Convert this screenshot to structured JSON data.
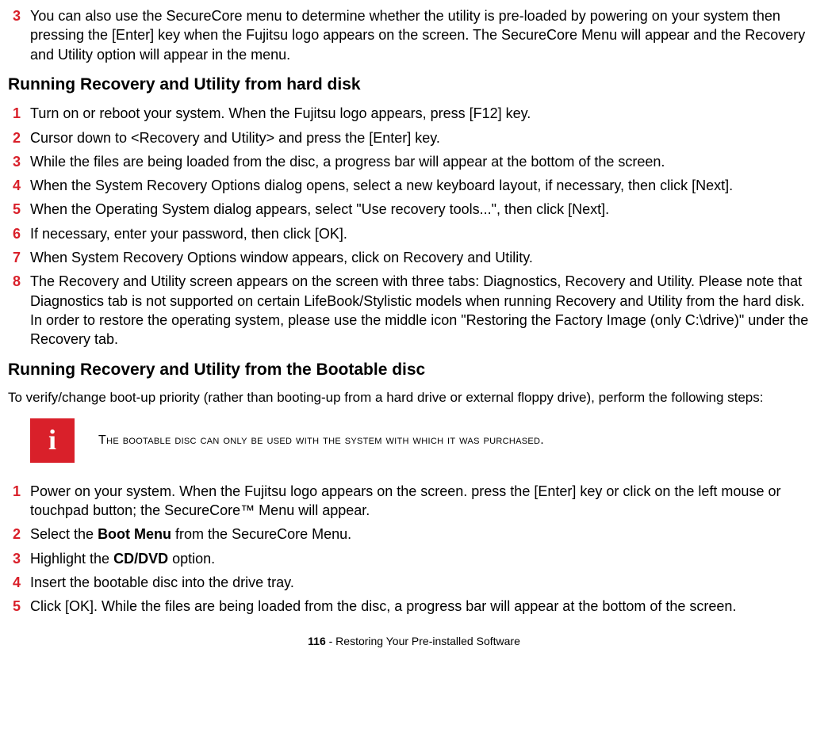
{
  "intro": {
    "num": "3",
    "text": "You can also use the SecureCore menu to determine whether the utility is pre-loaded by powering on your system then pressing the [Enter] key when the Fujitsu logo appears on the screen. The SecureCore Menu will appear and the Recovery and Utility option will appear in the menu."
  },
  "section1": {
    "heading": "Running Recovery and Utility from hard disk",
    "steps": [
      {
        "num": "1",
        "text": "Turn on or reboot your system. When the Fujitsu logo appears, press [F12] key."
      },
      {
        "num": "2",
        "text": "Cursor down to <Recovery and Utility> and press the [Enter] key."
      },
      {
        "num": "3",
        "text": "While the files are being loaded from the disc, a progress bar will appear at the bottom of the screen."
      },
      {
        "num": "4",
        "text": "When the System Recovery Options dialog opens, select a new keyboard layout, if necessary, then click [Next]."
      },
      {
        "num": "5",
        "text": "When the Operating System dialog appears, select \"Use recovery tools...\", then click [Next]."
      },
      {
        "num": "6",
        "text": "If necessary, enter your password, then click [OK]."
      },
      {
        "num": "7",
        "text": "When System Recovery Options window appears, click on Recovery and Utility."
      },
      {
        "num": "8",
        "text": "The Recovery and Utility screen appears on the screen with three tabs: Diagnostics, Recovery and Utility. Please note that Diagnostics tab is not supported on certain LifeBook/Stylistic models when running Recovery and Utility from the hard disk. In order to restore the operating system, please use the middle icon \"Restoring the Factory Image (only C:\\drive)\" under the Recovery tab."
      }
    ]
  },
  "section2": {
    "heading": "Running Recovery and Utility from the Bootable disc",
    "intro": "To verify/change boot-up priority (rather than booting-up from a hard drive or external floppy drive), perform the following steps:",
    "note": "The bootable disc can only be used with the system with which it was purchased.",
    "steps": [
      {
        "num": "1",
        "pre": "Power on your system. When the Fujitsu logo appears on the screen. press the [Enter] key or click on the left mouse or touchpad button; the SecureCore™ Menu will appear."
      },
      {
        "num": "2",
        "pre": "Select the ",
        "bold": "Boot Menu",
        "post": " from the SecureCore Menu."
      },
      {
        "num": "3",
        "pre": "Highlight the ",
        "bold": "CD/DVD",
        "post": " option."
      },
      {
        "num": "4",
        "pre": "Insert the bootable disc into the drive tray."
      },
      {
        "num": "5",
        "pre": "Click [OK]. While the files are being loaded from the disc, a progress bar will appear at the bottom of the screen."
      }
    ]
  },
  "footer": {
    "page": "116",
    "title": " - Restoring Your Pre-installed Software"
  },
  "info_icon_glyph": "i"
}
